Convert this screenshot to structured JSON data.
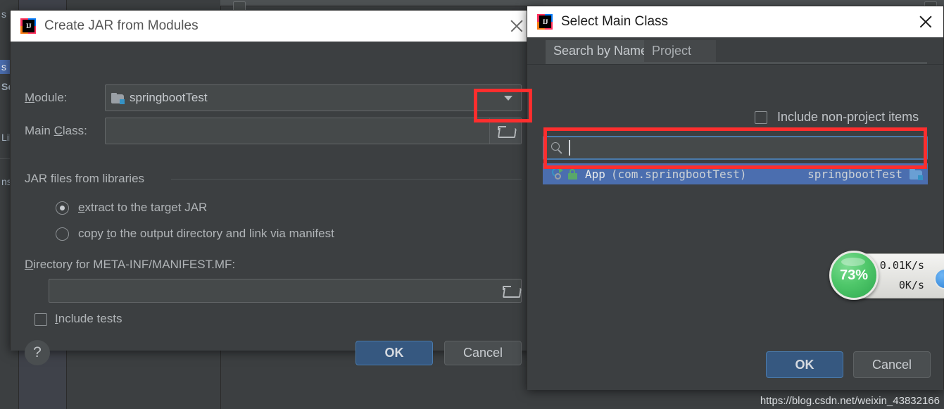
{
  "background": {
    "sidebar_items": [
      {
        "label": "s",
        "selected": false
      },
      {
        "label": "s",
        "selected": true
      },
      {
        "label": "Se",
        "selected": false,
        "bold": true
      },
      {
        "label": "Lib",
        "selected": false
      },
      {
        "label": "ns",
        "selected": false
      }
    ]
  },
  "jar_dialog": {
    "title": "Create JAR from Modules",
    "icon": "intellij-idea-icon",
    "close_icon": "close-icon",
    "module_label": "Module:",
    "module_value": "springbootTest",
    "module_icon": "module-folder-icon",
    "main_class_label": "Main Class:",
    "main_class_value": "",
    "browse_icon": "open-folder-icon",
    "group_title": "JAR files from libraries",
    "radio_extract": "extract to the target JAR",
    "radio_copy": "copy to the output directory and link via manifest",
    "radio_selected": "extract",
    "directory_label": "Directory for META-INF/MANIFEST.MF:",
    "directory_value": "",
    "directory_browse_icon": "open-folder-icon",
    "include_tests_label": "Include tests",
    "include_tests_checked": false,
    "help_label": "?",
    "ok_label": "OK",
    "cancel_label": "Cancel"
  },
  "main_class_dialog": {
    "title": "Select Main Class",
    "icon": "intellij-idea-icon",
    "close_icon": "close-icon",
    "tabs": [
      {
        "label": "Search by Name",
        "active": true
      },
      {
        "label": "Project",
        "active": false
      }
    ],
    "include_non_project_label": "Include non-project items",
    "include_non_project_checked": false,
    "search_placeholder": "",
    "search_value": "",
    "search_icon": "search-icon",
    "results": [
      {
        "name": "App",
        "package": "(com.springbootTest)",
        "module": "springbootTest",
        "class_icon": "runnable-class-icon",
        "lock_icon": "public-lock-icon",
        "module_icon": "module-folder-icon",
        "selected": true
      }
    ],
    "ok_label": "OK",
    "cancel_label": "Cancel"
  },
  "speed_widget": {
    "progress": "73%",
    "upload_icon": "arrow-up-icon",
    "upload_speed": "0.01K/s",
    "download_icon": "arrow-down-icon",
    "download_speed": "0K/s"
  },
  "watermark": "https://blog.csdn.net/weixin_43832166",
  "colors": {
    "accent_blue": "#4b6eaf",
    "primary_button": "#365880",
    "annotation_red": "#fd2e2e",
    "progress_green": "#4fc76a",
    "dialog_bg": "#3c3f41"
  }
}
